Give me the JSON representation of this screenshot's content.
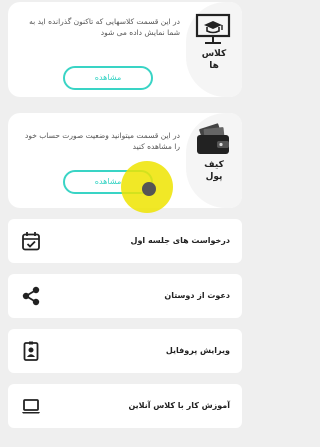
{
  "cards": [
    {
      "title_line1": "کلاس",
      "title_line2": "ها",
      "icon": "classroom-board-icon",
      "description": "در این قسمت کلاسهایی که تاکنون گذرانده اید به شما نمایش داده می شود",
      "button_label": "مشاهده"
    },
    {
      "title_line1": "کیف",
      "title_line2": "پول",
      "icon": "wallet-icon",
      "description": "در این قسمت میتوانید وضعیت صورت حساب خود را مشاهده کنید",
      "button_label": "مشاهده"
    }
  ],
  "menu": [
    {
      "label": "درخواست های جلسه اول",
      "icon": "calendar-check-icon"
    },
    {
      "label": "دعوت از دوستان",
      "icon": "share-icon"
    },
    {
      "label": "ویرایش پروفایل",
      "icon": "profile-badge-icon"
    },
    {
      "label": "آموزش کار با کلاس آنلاین",
      "icon": "laptop-icon"
    }
  ],
  "colors": {
    "accent": "#39d4c5",
    "background": "#efefef",
    "tap_indicator": "#eee400"
  }
}
